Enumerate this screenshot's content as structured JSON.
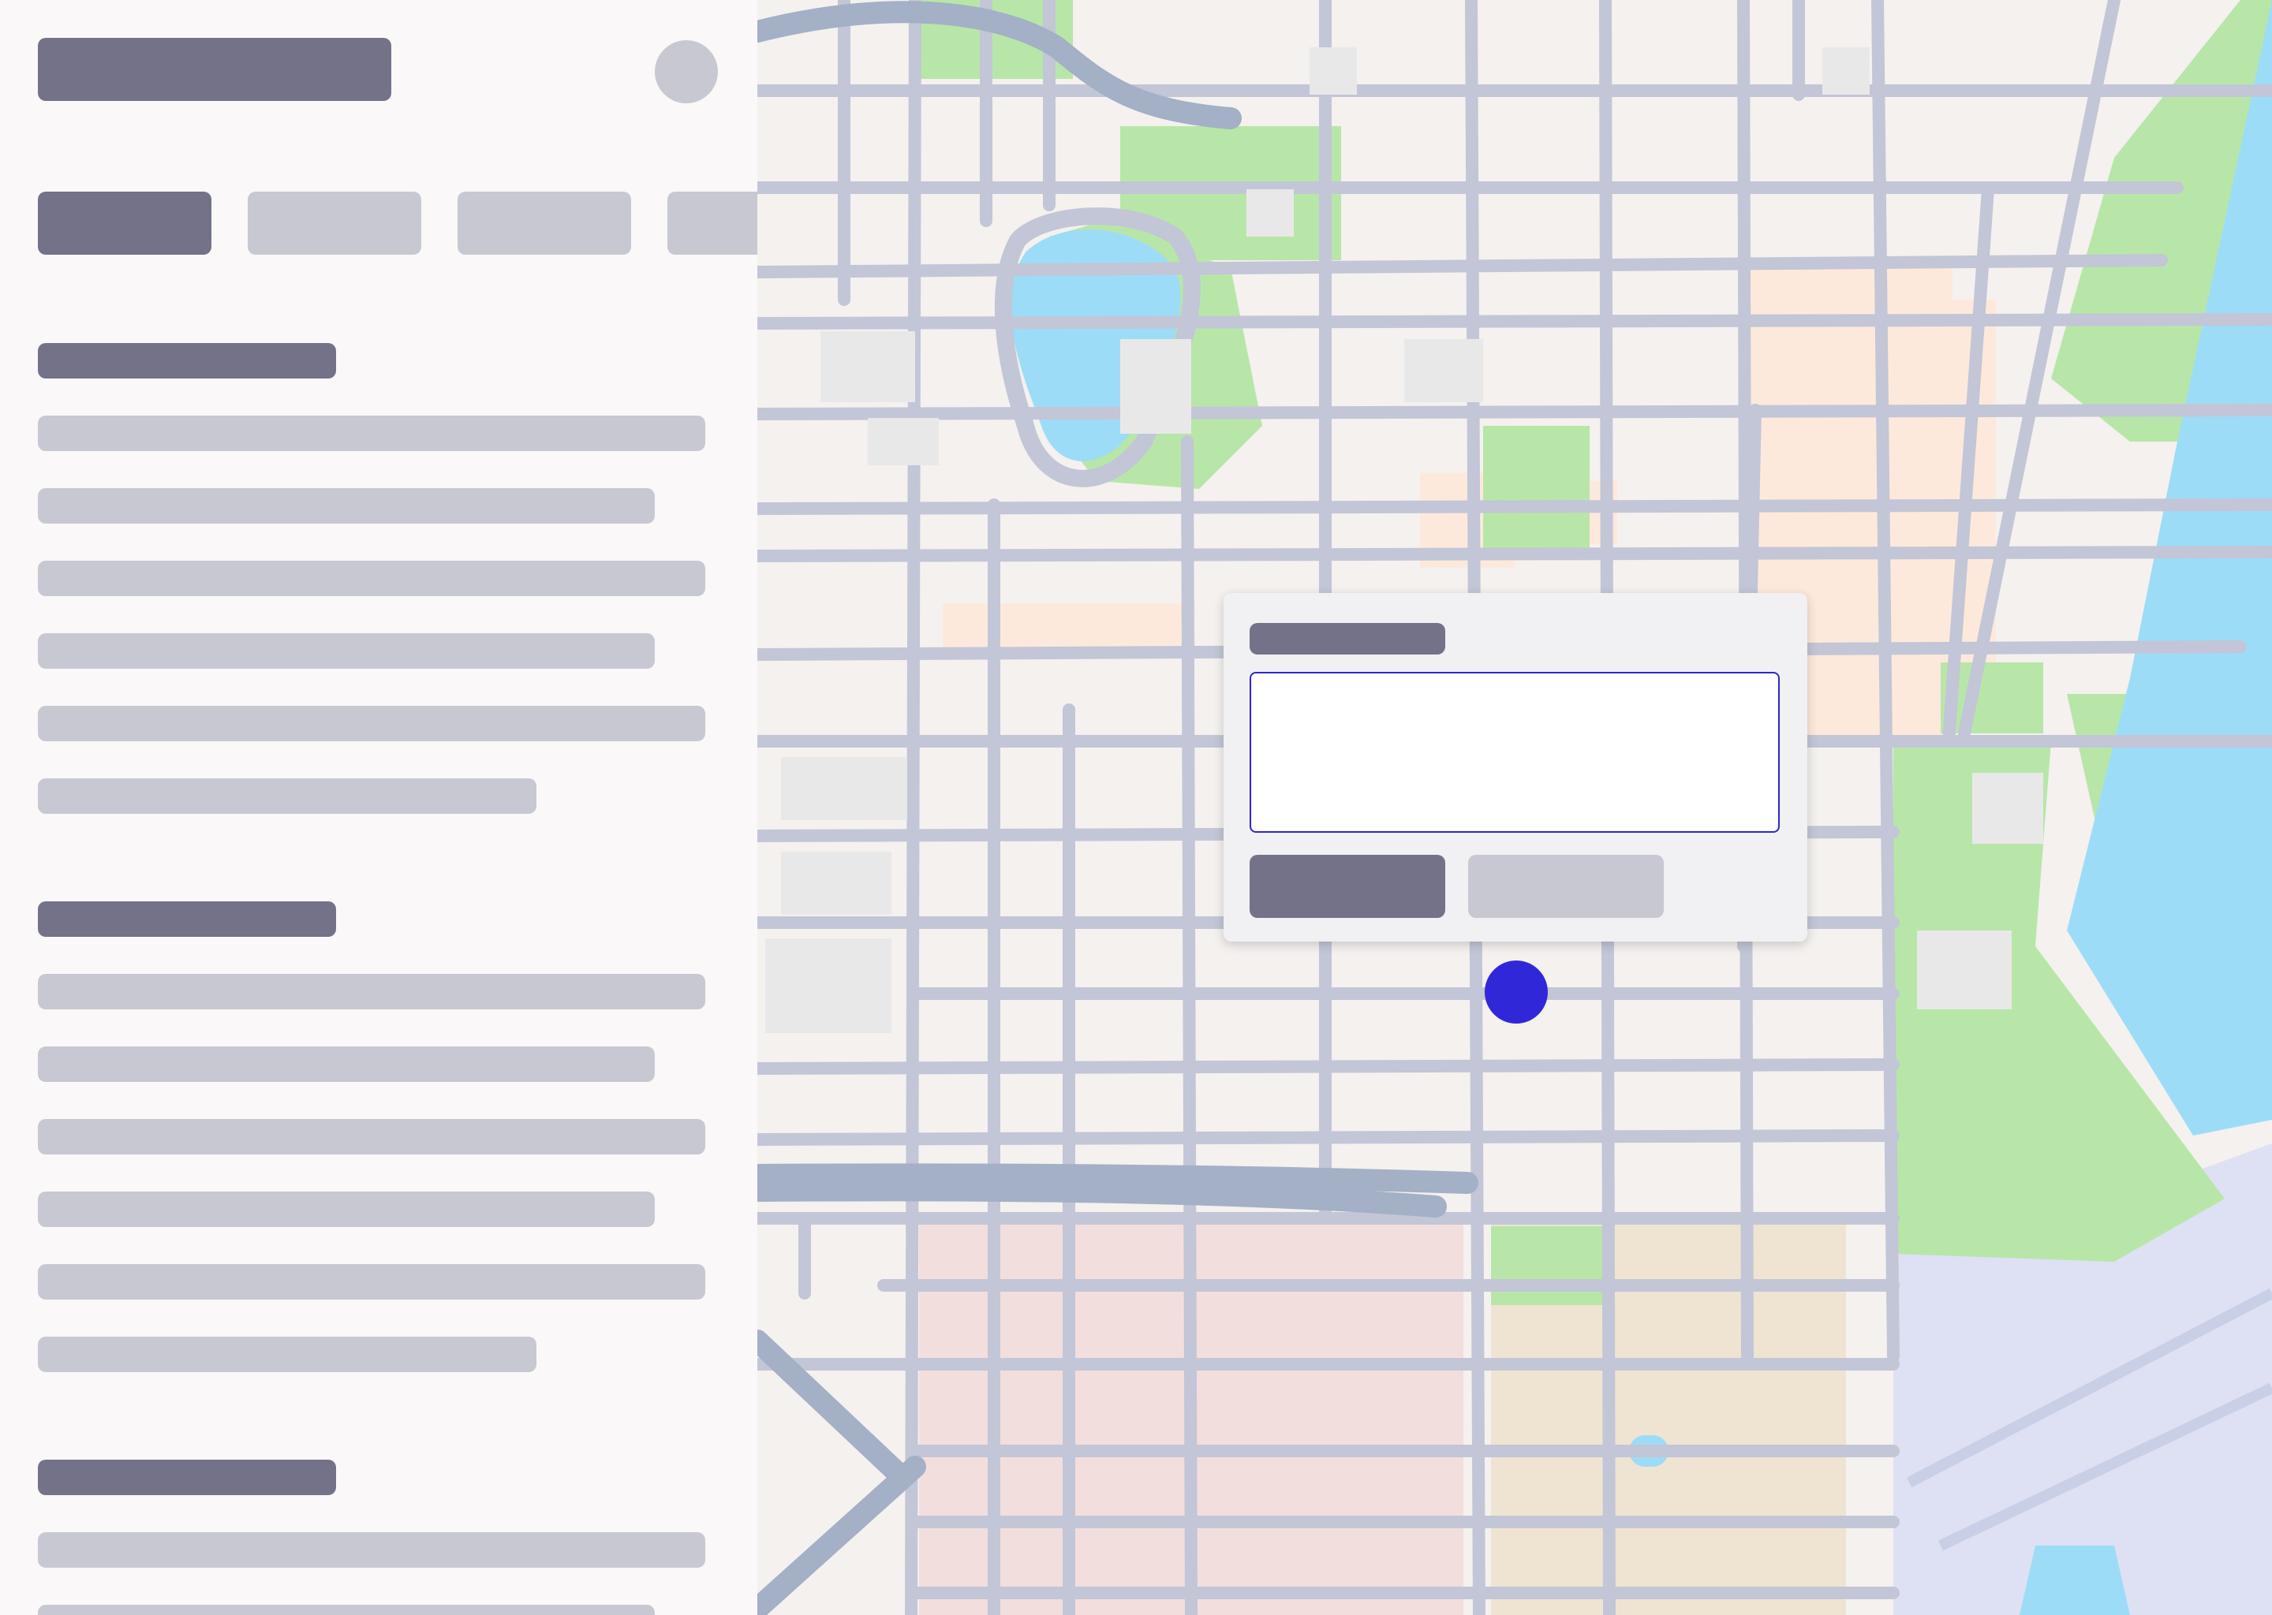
{
  "colors": {
    "placeholder_dark": "#737289",
    "placeholder_light": "#c8c8d2",
    "sidebar_background": "#faf8f8",
    "map_land": "#f4f1ef",
    "map_road": "#c2c6d6",
    "map_highway": "#a3b0c6",
    "map_water": "#9ddcf7",
    "map_park": "#b8e6a8",
    "map_commercial": "#fde9dc",
    "map_retail": "#f3dede",
    "map_industrial": "#efe4d2",
    "map_airport": "#dde1f3",
    "pin": "#3028d8",
    "input_border": "#2d27c8"
  },
  "icons": {
    "pin": "location-marker-icon",
    "avatar": "avatar-placeholder"
  },
  "sidebar": {
    "tabs": [
      "",
      "",
      "",
      ""
    ],
    "sections": [
      {
        "heading": "",
        "lines": 6
      },
      {
        "heading": "",
        "lines": 6
      },
      {
        "heading": "",
        "lines": 2
      }
    ]
  },
  "popup": {
    "title": "",
    "input_value": "",
    "primary_button": "",
    "secondary_button": ""
  }
}
